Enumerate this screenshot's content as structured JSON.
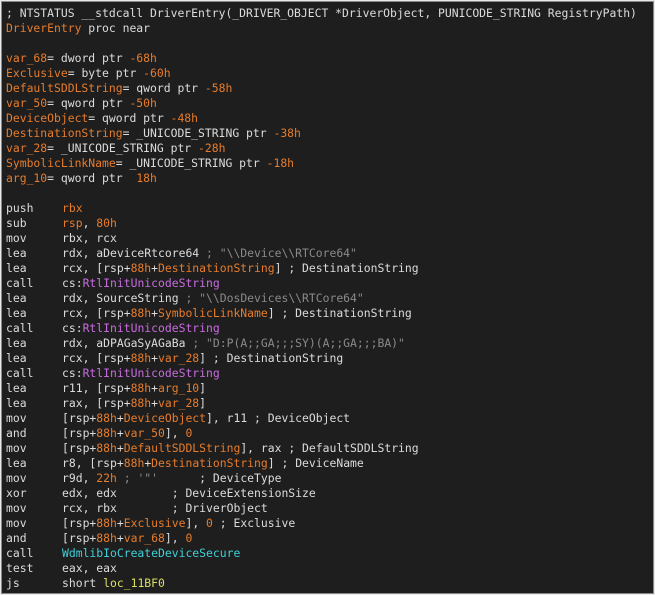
{
  "header": {
    "signature": "; NTSTATUS __stdcall DriverEntry(_DRIVER_OBJECT *DriverObject, PUNICODE_STRING RegistryPath)",
    "proc_name": "DriverEntry",
    "proc_suffix": " proc near"
  },
  "vars": [
    {
      "name": "var_68",
      "type": "= dword ptr ",
      "offset": "-68h"
    },
    {
      "name": "Exclusive",
      "type": "= byte ptr ",
      "offset": "-60h"
    },
    {
      "name": "DefaultSDDLString",
      "type": "= qword ptr ",
      "offset": "-58h"
    },
    {
      "name": "var_50",
      "type": "= qword ptr ",
      "offset": "-50h"
    },
    {
      "name": "DeviceObject",
      "type": "= qword ptr ",
      "offset": "-48h"
    },
    {
      "name": "DestinationString",
      "type": "= _UNICODE_STRING ptr ",
      "offset": "-38h"
    },
    {
      "name": "var_28",
      "type": "= _UNICODE_STRING ptr ",
      "offset": "-28h"
    },
    {
      "name": "SymbolicLinkName",
      "type": "= _UNICODE_STRING ptr ",
      "offset": "-18h"
    },
    {
      "name": "arg_10",
      "type": "= qword ptr  ",
      "offset": "18h"
    }
  ],
  "instructions": [
    {
      "m": "push",
      "p": [
        [
          "o",
          "rbx"
        ]
      ]
    },
    {
      "m": "sub",
      "p": [
        [
          "o",
          "rsp"
        ],
        [
          "w",
          ", "
        ],
        [
          "o",
          "80h"
        ]
      ]
    },
    {
      "m": "mov",
      "p": [
        [
          "w",
          "rbx, rcx"
        ]
      ]
    },
    {
      "m": "lea",
      "p": [
        [
          "w",
          "rdx, aDeviceRtcore64 "
        ],
        [
          "c",
          "; \"\\\\Device\\\\RTCore64\""
        ]
      ]
    },
    {
      "m": "lea",
      "p": [
        [
          "w",
          "rcx, [rsp+"
        ],
        [
          "o",
          "88h"
        ],
        [
          "w",
          "+"
        ],
        [
          "o",
          "DestinationString"
        ],
        [
          "w",
          "] ; DestinationString"
        ]
      ]
    },
    {
      "m": "call",
      "p": [
        [
          "w",
          "cs:"
        ],
        [
          "f",
          "RtlInitUnicodeString"
        ]
      ]
    },
    {
      "m": "lea",
      "p": [
        [
          "w",
          "rdx, SourceString "
        ],
        [
          "c",
          "; \"\\\\DosDevices\\\\RTCore64\""
        ]
      ]
    },
    {
      "m": "lea",
      "p": [
        [
          "w",
          "rcx, [rsp+"
        ],
        [
          "o",
          "88h"
        ],
        [
          "w",
          "+"
        ],
        [
          "o",
          "SymbolicLinkName"
        ],
        [
          "w",
          "] ; DestinationString"
        ]
      ]
    },
    {
      "m": "call",
      "p": [
        [
          "w",
          "cs:"
        ],
        [
          "f",
          "RtlInitUnicodeString"
        ]
      ]
    },
    {
      "m": "lea",
      "p": [
        [
          "w",
          "rdx, aDPAGaSyAGaBa "
        ],
        [
          "c",
          "; \"D:P(A;;GA;;;SY)(A;;GA;;;BA)\""
        ]
      ]
    },
    {
      "m": "lea",
      "p": [
        [
          "w",
          "rcx, [rsp+"
        ],
        [
          "o",
          "88h"
        ],
        [
          "w",
          "+"
        ],
        [
          "o",
          "var_28"
        ],
        [
          "w",
          "] ; DestinationString"
        ]
      ]
    },
    {
      "m": "call",
      "p": [
        [
          "w",
          "cs:"
        ],
        [
          "f",
          "RtlInitUnicodeString"
        ]
      ]
    },
    {
      "m": "lea",
      "p": [
        [
          "w",
          "r11, [rsp+"
        ],
        [
          "o",
          "88h"
        ],
        [
          "w",
          "+"
        ],
        [
          "o",
          "arg_10"
        ],
        [
          "w",
          "]"
        ]
      ]
    },
    {
      "m": "lea",
      "p": [
        [
          "w",
          "rax, [rsp+"
        ],
        [
          "o",
          "88h"
        ],
        [
          "w",
          "+"
        ],
        [
          "o",
          "var_28"
        ],
        [
          "w",
          "]"
        ]
      ]
    },
    {
      "m": "mov",
      "p": [
        [
          "w",
          "[rsp+"
        ],
        [
          "o",
          "88h"
        ],
        [
          "w",
          "+"
        ],
        [
          "o",
          "DeviceObject"
        ],
        [
          "w",
          "], r11 ; DeviceObject"
        ]
      ]
    },
    {
      "m": "and",
      "p": [
        [
          "w",
          "[rsp+"
        ],
        [
          "o",
          "88h"
        ],
        [
          "w",
          "+"
        ],
        [
          "o",
          "var_50"
        ],
        [
          "w",
          "], "
        ],
        [
          "o",
          "0"
        ]
      ]
    },
    {
      "m": "mov",
      "p": [
        [
          "w",
          "[rsp+"
        ],
        [
          "o",
          "88h"
        ],
        [
          "w",
          "+"
        ],
        [
          "o",
          "DefaultSDDLString"
        ],
        [
          "w",
          "], rax ; DefaultSDDLString"
        ]
      ]
    },
    {
      "m": "lea",
      "p": [
        [
          "w",
          "r8, [rsp+"
        ],
        [
          "o",
          "88h"
        ],
        [
          "w",
          "+"
        ],
        [
          "o",
          "DestinationString"
        ],
        [
          "w",
          "] ; DeviceName"
        ]
      ]
    },
    {
      "m": "mov",
      "p": [
        [
          "w",
          "r9d, "
        ],
        [
          "o",
          "22h"
        ],
        [
          "w",
          " "
        ],
        [
          "c",
          "; '\"'"
        ],
        [
          "w",
          "      ; DeviceType"
        ]
      ]
    },
    {
      "m": "xor",
      "p": [
        [
          "w",
          "edx, edx        ; DeviceExtensionSize"
        ]
      ]
    },
    {
      "m": "mov",
      "p": [
        [
          "w",
          "rcx, rbx        ; DriverObject"
        ]
      ]
    },
    {
      "m": "mov",
      "p": [
        [
          "w",
          "[rsp+"
        ],
        [
          "o",
          "88h"
        ],
        [
          "w",
          "+"
        ],
        [
          "o",
          "Exclusive"
        ],
        [
          "w",
          "], "
        ],
        [
          "o",
          "0"
        ],
        [
          "w",
          " ; Exclusive"
        ]
      ]
    },
    {
      "m": "and",
      "p": [
        [
          "w",
          "[rsp+"
        ],
        [
          "o",
          "88h"
        ],
        [
          "w",
          "+"
        ],
        [
          "o",
          "var_68"
        ],
        [
          "w",
          "], "
        ],
        [
          "o",
          "0"
        ]
      ]
    },
    {
      "m": "call",
      "p": [
        [
          "t",
          "WdmlibIoCreateDeviceSecure"
        ]
      ]
    },
    {
      "m": "test",
      "p": [
        [
          "w",
          "eax, eax"
        ]
      ]
    },
    {
      "m": "js",
      "p": [
        [
          "w",
          "short "
        ],
        [
          "y",
          "loc_11BF0"
        ]
      ]
    }
  ]
}
